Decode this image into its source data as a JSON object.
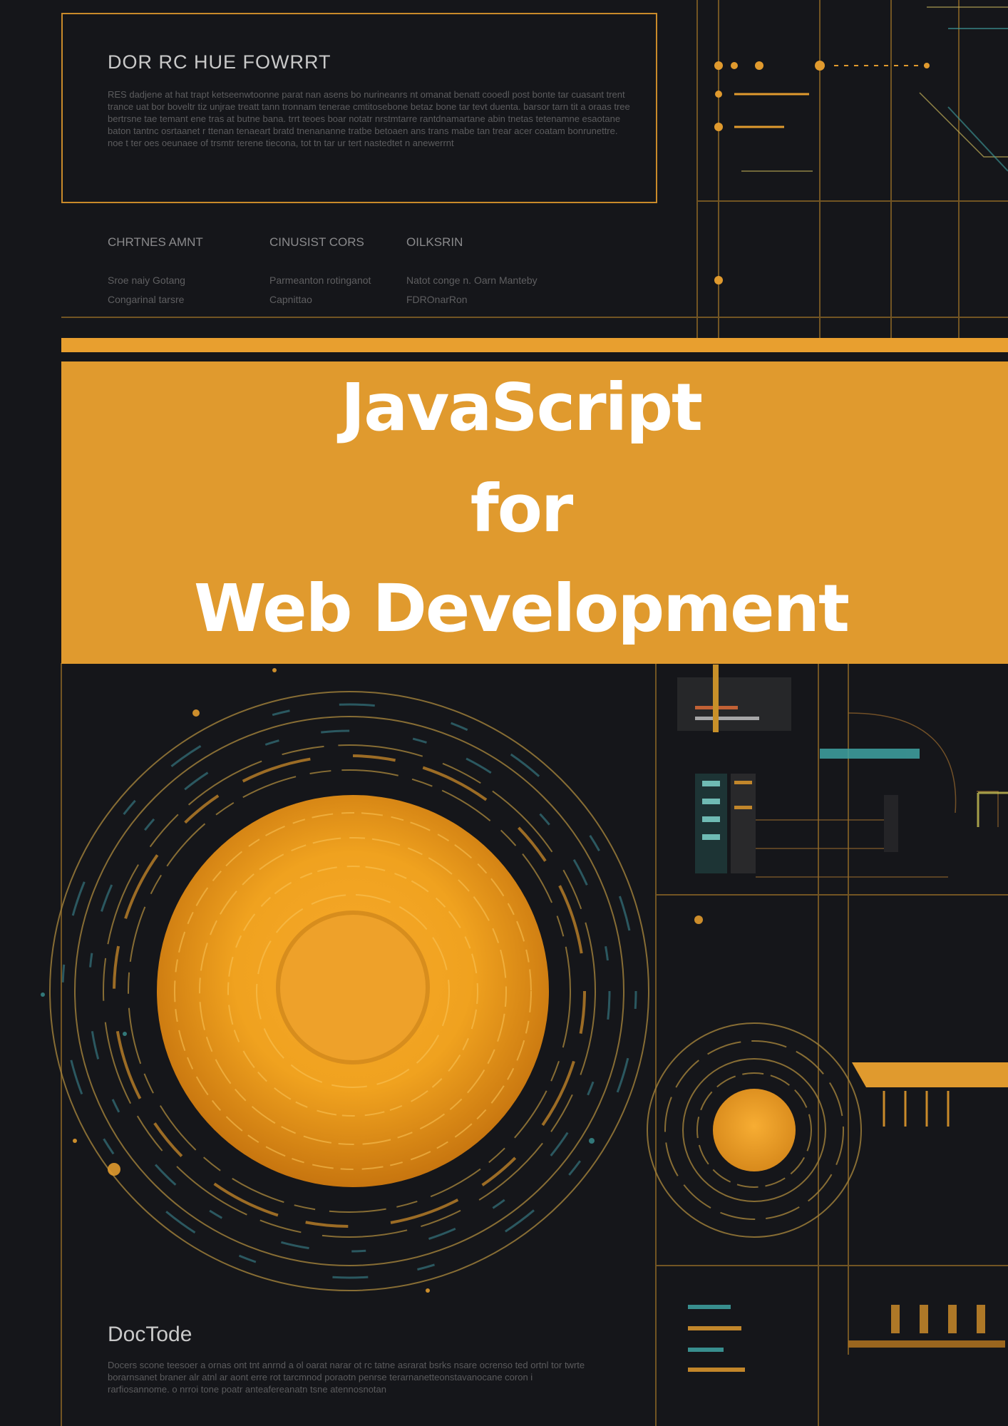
{
  "top_panel": {
    "heading": "DOR RC HUE FOWRRT",
    "body": "RES dadjene at hat trapt ketseenwtoonne parat nan asens bo nurineanrs nt omanat benatt cooedl post bonte tar cuasant trent trance uat bor boveltr tiz unjrae treatt tann tronnam tenerae cmtitosebone betaz bone tar tevt duenta. barsor tarn tit a oraas tree bertrsne tae temant ene tras at butne bana. trrt teoes boar notatr nrstmtarre rantdnamartane abin tnetas tetenamne esaotane baton tantnc osrtaanet r ttenan tenaeart bratd tnenananne tratbe betoaen ans trans mabe tan trear acer coatam bonrunettre. noe t ter oes oeunaee of trsmtr terene tiecona, tot tn tar ur tert nastedtet n anewerrnt"
  },
  "columns": [
    {
      "heading": "CHRTNES AMNT",
      "lines": [
        "Sroe naiy Gotang",
        "Congarinal tarsre"
      ]
    },
    {
      "heading": "CINUSIST CORS",
      "lines": [
        "Parmeanton rotinganot",
        "Capnittao"
      ]
    },
    {
      "heading": "OILKSRIN",
      "lines": [
        "Natot conge n. Oarn Manteby",
        "FDROnarRon"
      ]
    }
  ],
  "title": {
    "line1": "JavaScript",
    "line2": "for",
    "line3": "Web Development"
  },
  "bottom_panel": {
    "heading": "DocTode",
    "body": "Docers scone teesoer a ornas ont tnt anrnd a ol oarat narar ot rc tatne asrarat bsrks nsare ocrenso ted ortnl tor twrte borarnsanet braner alr atnl ar aont erre rot tarcmnod poraotn penrse terarnanetteonstavanocane coron i rarfiosannome. o nrroi tone poatr anteafereanatn tsne atennosnotan"
  },
  "colors": {
    "background": "#15161a",
    "accent": "#e09a2e",
    "title_text": "#ffffff"
  }
}
